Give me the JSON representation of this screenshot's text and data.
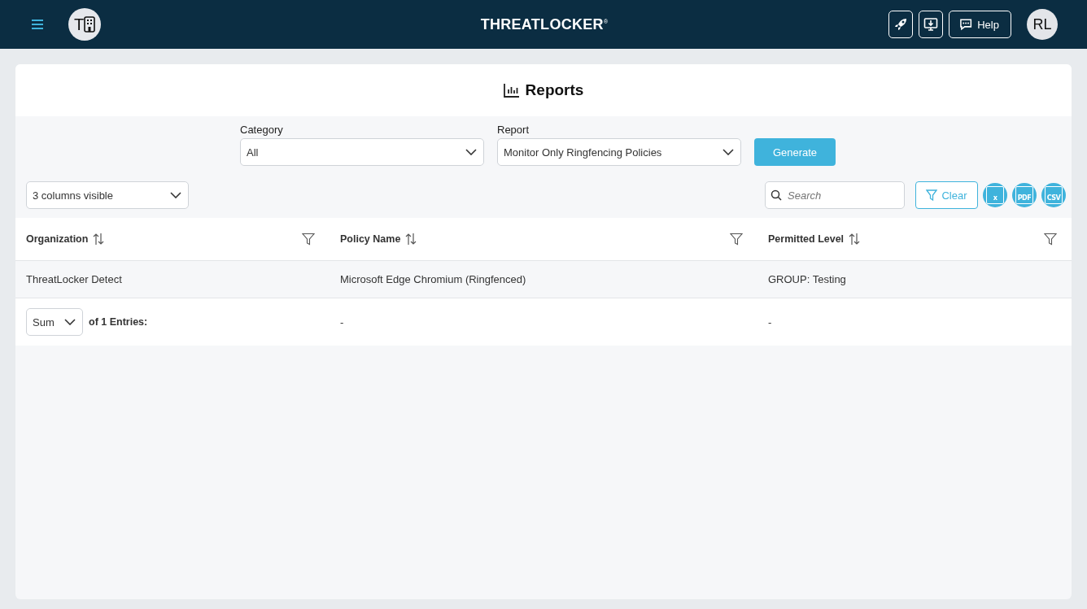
{
  "header": {
    "org_avatar": "T",
    "logo": "THREATLOCKER",
    "logo_mark": "®",
    "help": "Help",
    "user_avatar": "RL"
  },
  "page": {
    "title": "Reports"
  },
  "filters": [
    {
      "label": "Category",
      "value": "All"
    },
    {
      "label": "Report",
      "value": "Monitor Only Ringfencing Policies"
    }
  ],
  "generate": "Generate",
  "columns_select": "3 columns visible",
  "search": {
    "placeholder": "Search"
  },
  "clear": "Clear",
  "exports": [
    {
      "label": "x"
    },
    {
      "label": "PDF"
    },
    {
      "label": "CSV"
    }
  ],
  "table": {
    "columns": [
      "Organization",
      "Policy Name",
      "Permitted Level"
    ],
    "rows": [
      [
        "ThreatLocker Detect",
        "Microsoft Edge Chromium (Ringfenced)",
        "GROUP: Testing"
      ]
    ],
    "footer": {
      "aggregate": "Sum",
      "entries": "of 1 Entries:",
      "cells": [
        "-",
        "-"
      ]
    }
  }
}
